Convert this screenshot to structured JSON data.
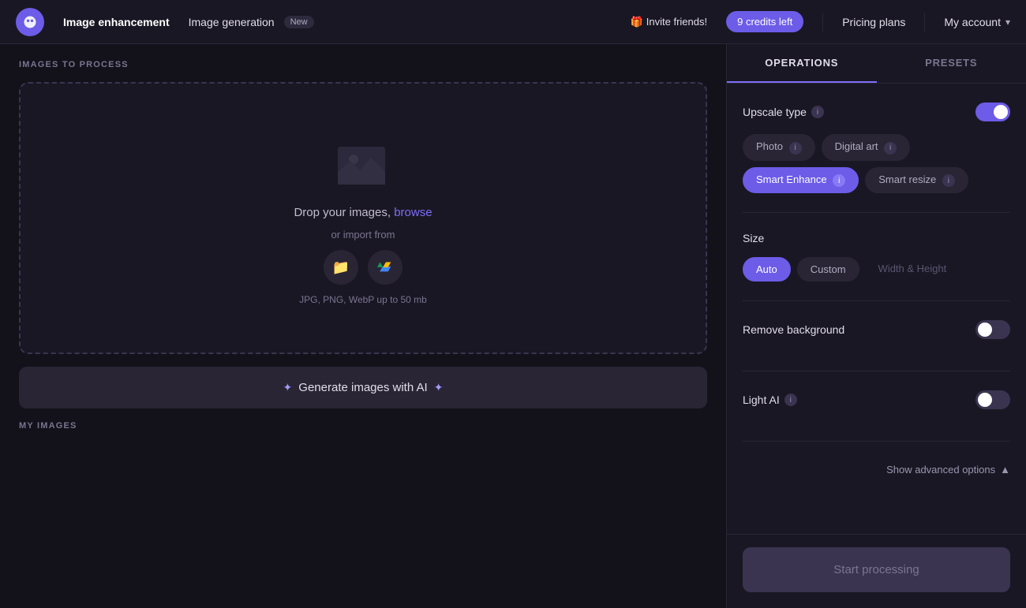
{
  "header": {
    "logo_label": "App logo",
    "nav_image_enhancement": "Image enhancement",
    "nav_image_generation": "Image generation",
    "badge_new": "New",
    "invite_emoji": "🎁",
    "invite_text": "Invite friends!",
    "credits_text": "9 credits left",
    "pricing_plans": "Pricing plans",
    "my_account": "My account"
  },
  "left_panel": {
    "section_title": "IMAGES TO PROCESS",
    "drop_zone": {
      "drop_text": "Drop your images,",
      "browse_text": "browse",
      "import_text": "or import from",
      "file_types": "JPG, PNG, WebP up to 50 mb"
    },
    "generate_btn": "✦ Generate images with AI ✦",
    "my_images_title": "MY IMAGES"
  },
  "right_panel": {
    "tab_operations": "OPERATIONS",
    "tab_presets": "PRESETS",
    "upscale_type": {
      "label": "Upscale type",
      "enabled": true,
      "options": [
        "Photo",
        "Digital art",
        "Smart Enhance",
        "Smart resize"
      ],
      "active_option": "Smart Enhance"
    },
    "size": {
      "label": "Size",
      "options": [
        "Auto",
        "Custom",
        "Width & Height"
      ],
      "active_option": "Auto"
    },
    "remove_background": {
      "label": "Remove background",
      "enabled": false
    },
    "light_ai": {
      "label": "Light AI",
      "enabled": false
    },
    "show_advanced": "Show advanced options",
    "start_processing": "Start processing"
  }
}
